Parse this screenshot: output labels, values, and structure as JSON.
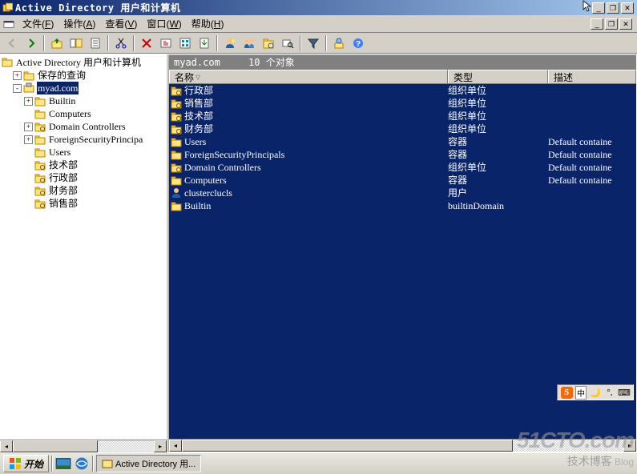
{
  "window": {
    "title": "Active Directory 用户和计算机"
  },
  "menu": {
    "file": "文件",
    "file_u": "F",
    "action": "操作",
    "action_u": "A",
    "view": "查看",
    "view_u": "V",
    "window": "窗口",
    "window_u": "W",
    "help": "帮助",
    "help_u": "H"
  },
  "tree": {
    "root": "Active Directory 用户和计算机",
    "items": [
      {
        "exp": "+",
        "indent": 14,
        "icon": "folder",
        "label": "保存的查询"
      },
      {
        "exp": "-",
        "indent": 14,
        "icon": "domain",
        "label": "myad.com",
        "selected": true
      },
      {
        "exp": "+",
        "indent": 28,
        "icon": "folder",
        "label": "Builtin"
      },
      {
        "exp": "",
        "indent": 28,
        "icon": "folder",
        "label": "Computers"
      },
      {
        "exp": "+",
        "indent": 28,
        "icon": "ou",
        "label": "Domain Controllers"
      },
      {
        "exp": "+",
        "indent": 28,
        "icon": "folder",
        "label": "ForeignSecurityPrincipa"
      },
      {
        "exp": "",
        "indent": 28,
        "icon": "folder",
        "label": "Users"
      },
      {
        "exp": "",
        "indent": 28,
        "icon": "ou",
        "label": "技术部"
      },
      {
        "exp": "",
        "indent": 28,
        "icon": "ou",
        "label": "行政部"
      },
      {
        "exp": "",
        "indent": 28,
        "icon": "ou",
        "label": "财务部"
      },
      {
        "exp": "",
        "indent": 28,
        "icon": "ou",
        "label": "销售部"
      }
    ]
  },
  "pathbar": {
    "path": "myad.com",
    "count": "10 个对象"
  },
  "columns": {
    "name": "名称",
    "type": "类型",
    "desc": "描述"
  },
  "rows": [
    {
      "icon": "ou",
      "name": "行政部",
      "type": "组织单位",
      "desc": ""
    },
    {
      "icon": "ou",
      "name": "销售部",
      "type": "组织单位",
      "desc": ""
    },
    {
      "icon": "ou",
      "name": "技术部",
      "type": "组织单位",
      "desc": ""
    },
    {
      "icon": "ou",
      "name": "财务部",
      "type": "组织单位",
      "desc": ""
    },
    {
      "icon": "folder",
      "name": "Users",
      "type": "容器",
      "desc": "Default containe"
    },
    {
      "icon": "folder",
      "name": "ForeignSecurityPrincipals",
      "type": "容器",
      "desc": "Default containe"
    },
    {
      "icon": "ou",
      "name": "Domain Controllers",
      "type": "组织单位",
      "desc": "Default containe"
    },
    {
      "icon": "folder",
      "name": "Computers",
      "type": "容器",
      "desc": "Default containe"
    },
    {
      "icon": "user",
      "name": "clusterclucls",
      "type": "用户",
      "desc": ""
    },
    {
      "icon": "folder",
      "name": "Builtin",
      "type": "builtinDomain",
      "desc": ""
    }
  ],
  "taskbar": {
    "start": "开始",
    "task": "Active Directory 用..."
  },
  "tray": {
    "s": "S",
    "zh": "中",
    "kb": "⌨"
  },
  "watermark": {
    "line1": "51CTO.com",
    "line2": "技术博客",
    "line3": "Blog"
  }
}
